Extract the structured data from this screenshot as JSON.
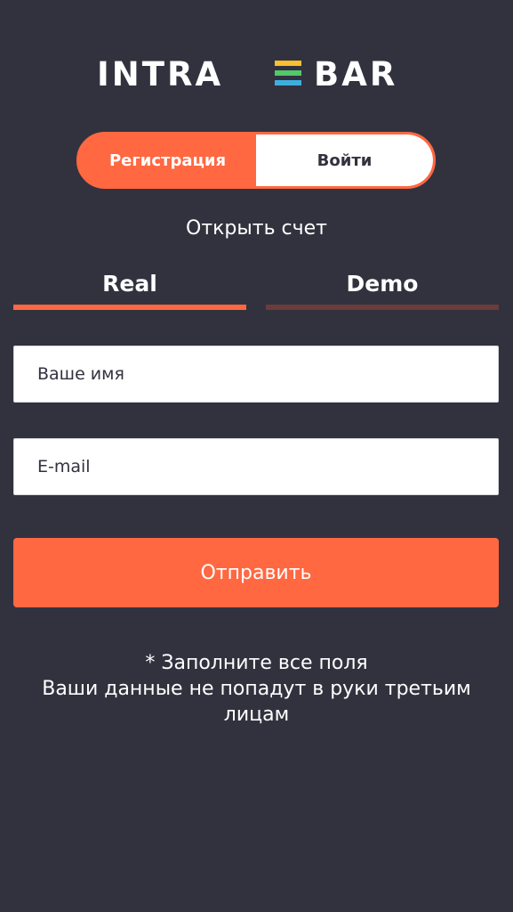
{
  "logo": {
    "text_left": "INTRA",
    "text_right": "BAR",
    "stripe_colors": [
      "#f9c12f",
      "#52c86a",
      "#3eaee0"
    ]
  },
  "auth_toggle": {
    "register_label": "Регистрация",
    "login_label": "Войти",
    "active": "register"
  },
  "open_account_title": "Открыть счет",
  "account_tabs": [
    {
      "label": "Real",
      "active": true
    },
    {
      "label": "Demo",
      "active": false
    }
  ],
  "form": {
    "name_placeholder": "Ваше имя",
    "email_placeholder": "E-mail",
    "submit_label": "Отправить"
  },
  "notes": {
    "line1": "* Заполните все поля",
    "line2": "Ваши данные не попадут в руки третьим лицам"
  },
  "colors": {
    "background": "#32323f",
    "accent": "#ff6841",
    "inactive_tab": "#6b3c3a",
    "field_bg": "#ffffff"
  }
}
